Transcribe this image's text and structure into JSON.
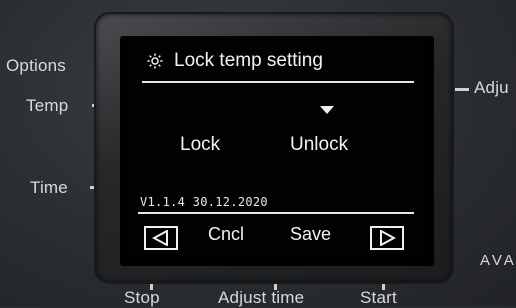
{
  "panel": {
    "left_labels": {
      "options": "Options",
      "temp": "Temp",
      "time": "Time"
    },
    "right_labels": {
      "adjust": "Adju",
      "ava": "AVA"
    },
    "bottom_labels": {
      "stop": "Stop",
      "adjust_time": "Adjust time",
      "start": "Start"
    }
  },
  "screen": {
    "title": "Lock temp setting",
    "title_icon": "gear-icon",
    "options": [
      "Lock",
      "Unlock"
    ],
    "selected_option": "Unlock",
    "version": "V1.1.4 30.12.2020",
    "buttons": {
      "cancel": "Cncl",
      "save": "Save",
      "left_icon": "left-arrow-icon",
      "right_icon": "right-arrow-icon"
    }
  },
  "colors": {
    "screen_bg": "#020202",
    "screen_fg": "#f2f2f2",
    "panel_bg": "#2b2e31"
  }
}
